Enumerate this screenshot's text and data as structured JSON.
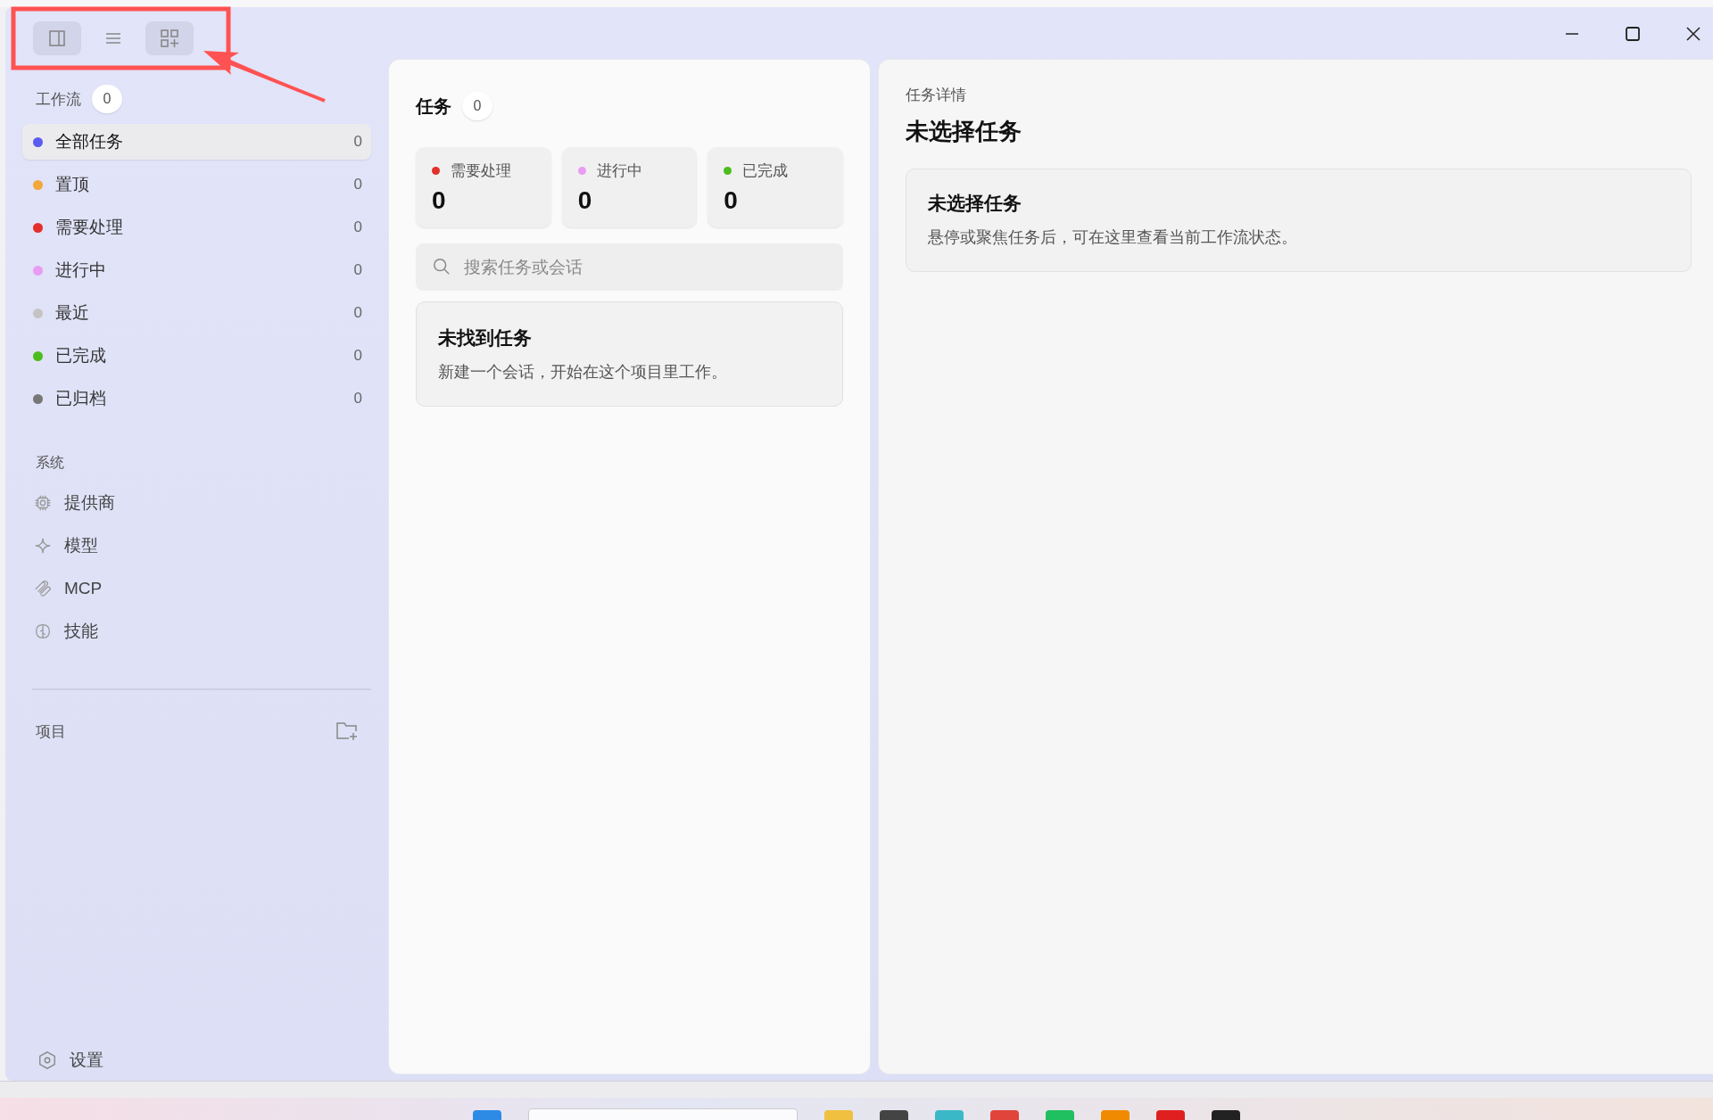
{
  "toolbar": [
    {
      "kind": "sidebar",
      "on": true
    },
    {
      "kind": "list",
      "on": false
    },
    {
      "kind": "grid-plus",
      "on": true
    }
  ],
  "sidebar": {
    "workflow": {
      "label": "工作流",
      "count": "0"
    },
    "items": [
      {
        "label": "全部任务",
        "count": "0",
        "color": "#5a5cf2",
        "selected": true
      },
      {
        "label": "置顶",
        "count": "0",
        "color": "#f2a83a",
        "selected": false
      },
      {
        "label": "需要处理",
        "count": "0",
        "color": "#e3302a",
        "selected": false
      },
      {
        "label": "进行中",
        "count": "0",
        "color": "#e99cf2",
        "selected": false
      },
      {
        "label": "最近",
        "count": "0",
        "color": "#c4c4c4",
        "selected": false
      },
      {
        "label": "已完成",
        "count": "0",
        "color": "#4bbd1c",
        "selected": false
      },
      {
        "label": "已归档",
        "count": "0",
        "color": "#777777",
        "selected": false
      }
    ],
    "system": {
      "label": "系统",
      "items": [
        {
          "kind": "chip",
          "label": "提供商"
        },
        {
          "kind": "sparkle",
          "label": "模型"
        },
        {
          "kind": "clip",
          "label": "MCP"
        },
        {
          "kind": "brain",
          "label": "技能"
        }
      ]
    },
    "projects": {
      "label": "项目"
    },
    "settings": {
      "label": "设置"
    }
  },
  "tasks": {
    "title": "任务",
    "count": "0",
    "stats": [
      {
        "label": "需要处理",
        "value": "0",
        "color": "#e3302a"
      },
      {
        "label": "进行中",
        "value": "0",
        "color": "#e99cf2"
      },
      {
        "label": "已完成",
        "value": "0",
        "color": "#4bbd1c"
      }
    ],
    "search": {
      "placeholder": "搜索任务或会话"
    },
    "empty": {
      "title": "未找到任务",
      "text": "新建一个会话，开始在这个项目里工作。"
    }
  },
  "detail": {
    "eyebrow": "任务详情",
    "title": "未选择任务",
    "card": {
      "title": "未选择任务",
      "text": "悬停或聚焦任务后，可在这里查看当前工作流状态。"
    }
  }
}
